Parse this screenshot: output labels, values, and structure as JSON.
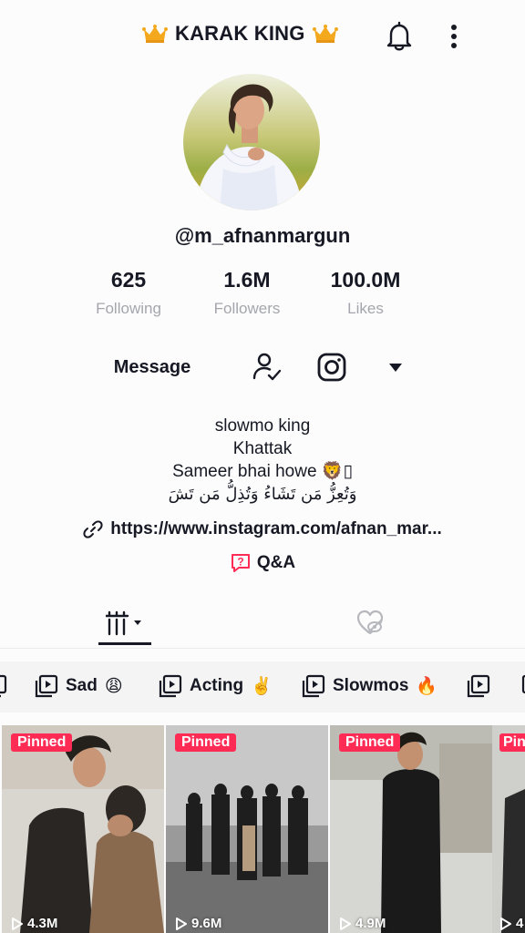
{
  "header": {
    "title": "KARAK KING",
    "bell_icon": "bell-icon",
    "more_icon": "more-vertical-icon",
    "crown_color": "#f4a81d"
  },
  "profile": {
    "username": "@m_afnanmargun",
    "avatar_icon": "avatar-photo"
  },
  "stats": [
    {
      "value": "625",
      "label": "Following"
    },
    {
      "value": "1.6M",
      "label": "Followers"
    },
    {
      "value": "100.0M",
      "label": "Likes"
    }
  ],
  "actions": {
    "message_label": "Message",
    "follow_icon": "user-check-icon",
    "instagram_icon": "instagram-icon",
    "dropdown_icon": "caret-down-icon"
  },
  "bio": {
    "line1": "slowmo king",
    "line2": "Khattak",
    "line3": "Sameer bhai howe 🦁▯",
    "line4": "وَتُعِزُّ مَن تَشَاءُ وَتُذِلُّ مَن تَشَ"
  },
  "link": {
    "text": "https://www.instagram.com/afnan_mar...",
    "icon": "link-icon"
  },
  "qa": {
    "label": "Q&A",
    "icon": "qa-icon",
    "color": "#fe2c55"
  },
  "tabs": {
    "videos_icon": "grid-icon",
    "liked_icon": "liked-hidden-icon"
  },
  "playlists": [
    {
      "label": "Sad",
      "emoji": "😩"
    },
    {
      "label": "Acting",
      "emoji": "✌️"
    },
    {
      "label": "Slowmos",
      "emoji": "🔥"
    }
  ],
  "videos": [
    {
      "pinned": "Pinned",
      "views": "4.3M"
    },
    {
      "pinned": "Pinned",
      "views": "9.6M"
    },
    {
      "pinned": "Pinned",
      "views": "4.9M"
    },
    {
      "pinned": "Pin",
      "views": "4"
    }
  ],
  "colors": {
    "accent": "#fe2c55",
    "text": "#161823",
    "secondary": "#a5a6ad"
  }
}
